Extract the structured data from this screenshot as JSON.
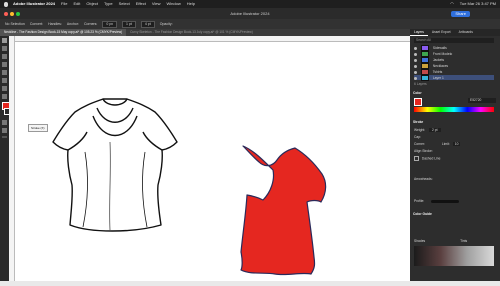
{
  "menubar": {
    "app": "Adobe Illustrator 2024",
    "items": [
      "File",
      "Edit",
      "Object",
      "Type",
      "Select",
      "Effect",
      "View",
      "Window",
      "Help"
    ],
    "clock": "Tue Mar 26  3:47 PM"
  },
  "window": {
    "title": "Adobe Illustrator 2024",
    "share_label": "Share",
    "colors": {
      "close": "#fe5f57",
      "minimize": "#febc2e",
      "zoom": "#28c840"
    }
  },
  "control_bar": {
    "selection": "No Selection",
    "items": [
      "Convert:",
      "Handles:",
      "Anchor:",
      "Corners:",
      "Opacity:"
    ],
    "corner_value": "0 px",
    "stroke_value": "1 pt",
    "width_value": "4 pt"
  },
  "tabs": [
    {
      "label": "Neckline - The Fashion Design Book-15 May copy.ai* @ 105.23 % (CMYK/Preview)",
      "active": true
    },
    {
      "label": "Curvy Skeleton - The Fashion Design Book-13 July copy.ai* @ 101 % (CMYK/Preview)",
      "active": false
    }
  ],
  "tooltip": "Stroke (X)",
  "panel": {
    "tabs": [
      "Layers",
      "Asset Export",
      "Artboards"
    ],
    "search_placeholder": "Search All",
    "layers": [
      {
        "name": "Sidewalls",
        "color": "#8a5cf0"
      },
      {
        "name": "Front Modelo",
        "color": "#3ea54f"
      },
      {
        "name": "Jackets",
        "color": "#3f72dc"
      },
      {
        "name": "Necklaces",
        "color": "#c9a13b"
      },
      {
        "name": "Tshirts",
        "color": "#c14a4a"
      },
      {
        "name": "Layer 1",
        "color": "#38b4d8"
      }
    ],
    "layer_count": "6 Layers",
    "color_section": "Color",
    "hex_value": "E52720",
    "stroke_section": "Stroke",
    "weight_label": "Weight:",
    "weight_value": "2 pt",
    "cap_label": "Cap:",
    "corner_label": "Corner:",
    "limit_label": "Limit:",
    "limit_value": "10",
    "align_label": "Align Stroke:",
    "dashed_label": "Dashed Line",
    "arrowheads_label": "Arrowheads:",
    "profile_label": "Profile:",
    "guide_section": "Color Guide",
    "harmony_labels": [
      "Shades",
      "Tints"
    ],
    "fill_color": "#e52720"
  }
}
